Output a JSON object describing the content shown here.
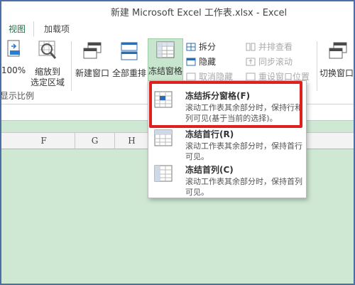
{
  "window": {
    "title": "新建 Microsoft Excel 工作表.xlsx - Excel"
  },
  "tabs": [
    {
      "label": "视图"
    },
    {
      "label": "加载项"
    }
  ],
  "ribbon": {
    "zoom100_label": "100%",
    "zoom_selection_label_1": "缩放到",
    "zoom_selection_label_2": "选定区域",
    "group_zoom_label": "显示比例",
    "new_window_label": "新建窗口",
    "arrange_all_label": "全部重排",
    "freeze_panes_label": "冻结窗格",
    "split_label": "拆分",
    "hide_label": "隐藏",
    "unhide_label": "取消隐藏",
    "side_by_side_label": "并排查看",
    "sync_scroll_label": "同步滚动",
    "reset_position_label": "重设窗口位置",
    "switch_windows_label": "切换窗口"
  },
  "columns": [
    "F",
    "G",
    "H"
  ],
  "freeze_menu": {
    "items": [
      {
        "title": "冻结拆分窗格(F)",
        "desc": "滚动工作表其余部分时，保持行和列可见(基于当前的选择)。"
      },
      {
        "title": "冻结首行(R)",
        "desc": "滚动工作表其余部分时，保持首行可见。"
      },
      {
        "title": "冻结首列(C)",
        "desc": "滚动工作表其余部分时，保持首列可见。"
      }
    ]
  },
  "colors": {
    "accent": "#217346",
    "highlight": "#e0201f",
    "sheet_bg": "#cfe8d4"
  }
}
